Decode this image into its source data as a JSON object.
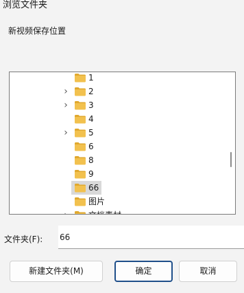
{
  "window": {
    "title": "浏览文件夹"
  },
  "prompt": "新视频保存位置",
  "tree": {
    "items": [
      {
        "label": "1",
        "expandable": false,
        "selected": false,
        "icon": "folder-icon"
      },
      {
        "label": "2",
        "expandable": true,
        "selected": false,
        "icon": "folder-icon"
      },
      {
        "label": "3",
        "expandable": true,
        "selected": false,
        "icon": "folder-icon"
      },
      {
        "label": "4",
        "expandable": false,
        "selected": false,
        "icon": "folder-icon"
      },
      {
        "label": "5",
        "expandable": true,
        "selected": false,
        "icon": "folder-icon"
      },
      {
        "label": "6",
        "expandable": false,
        "selected": false,
        "icon": "folder-icon"
      },
      {
        "label": "8",
        "expandable": false,
        "selected": false,
        "icon": "folder-icon"
      },
      {
        "label": "9",
        "expandable": false,
        "selected": false,
        "icon": "folder-icon"
      },
      {
        "label": "66",
        "expandable": false,
        "selected": true,
        "icon": "folder-icon"
      },
      {
        "label": "图片",
        "expandable": false,
        "selected": false,
        "icon": "folder-icon"
      },
      {
        "label": "文档素材",
        "expandable": true,
        "selected": false,
        "icon": "folder-icon"
      }
    ]
  },
  "folder_field": {
    "label": "文件夹(F):",
    "value": "66"
  },
  "buttons": {
    "new_folder": "新建文件夹(M)",
    "ok": "确定",
    "cancel": "取消"
  },
  "colors": {
    "folder": "#f2c14e",
    "folder_tab": "#e0a82e",
    "selection": "#d9d9d9",
    "primary_border": "#1f4f8a"
  }
}
